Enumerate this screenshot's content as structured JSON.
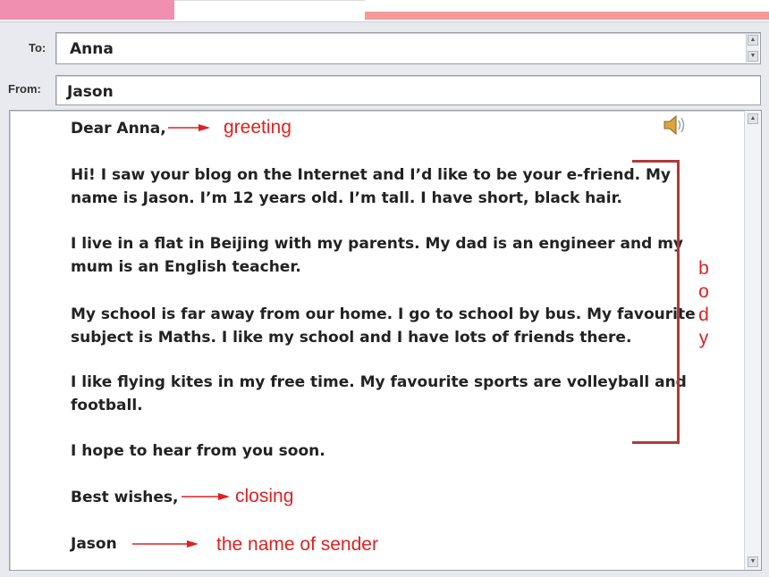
{
  "header": {
    "to_label": "To:",
    "to_value": "Anna",
    "from_label": "From:",
    "from_value": "Jason"
  },
  "letter": {
    "greeting": "Dear Anna,",
    "p1_line1": "Hi! I saw your blog on the Internet and I’d like to be your e-friend. My",
    "p1_line2": "name is Jason. I’m 12 years old. I’m tall. I have short, black hair.",
    "p2_line1": "I live in a flat in Beijing with my parents. My dad is an engineer and my",
    "p2_line2": "mum is an English teacher.",
    "p3_line1": "My school is far away from our home. I go to school by bus. My favourite",
    "p3_line2": "subject is Maths. I like my school and I have lots of friends there.",
    "p4_line1": "I like flying kites in my free time. My favourite sports are volleyball and",
    "p4_line2": "football.",
    "p5": "I hope to hear from you soon.",
    "closing": "Best wishes,",
    "sender": "Jason"
  },
  "annotations": {
    "greeting": "greeting",
    "body_letters": [
      "b",
      "o",
      "d",
      "y"
    ],
    "closing": "closing",
    "sender": "the name of sender"
  },
  "colors": {
    "annotation": "#e02020",
    "bracket": "#b03a3a",
    "tab_pink": "#f08fb0",
    "tab_salmon": "#f59a9a"
  },
  "icons": {
    "speaker": "speaker-icon"
  }
}
